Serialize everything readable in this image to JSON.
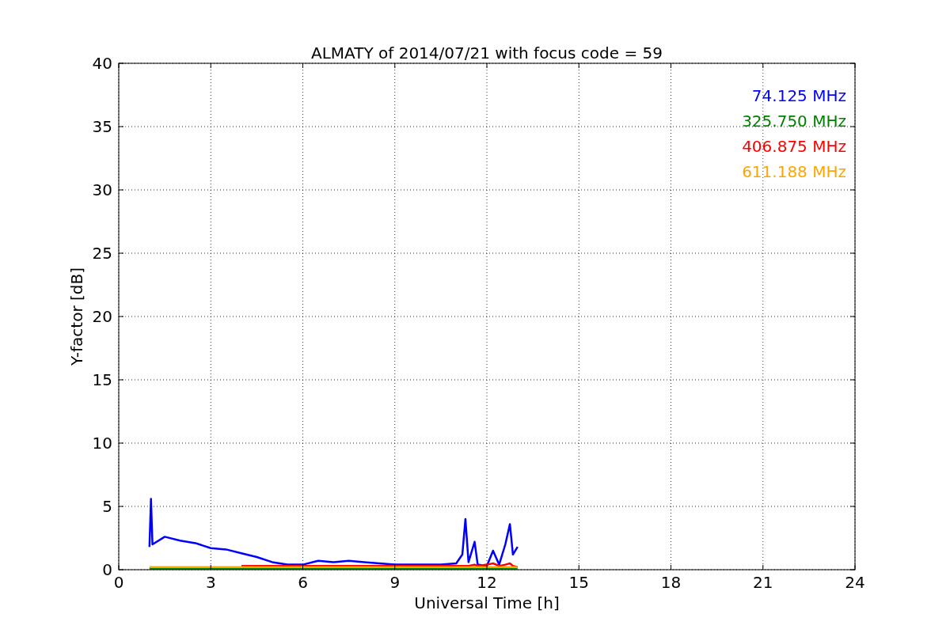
{
  "figure": {
    "chart_data": {
      "type": "line",
      "title": "ALMATY of 2014/07/21 with focus code = 59",
      "xlabel": "Universal Time [h]",
      "ylabel": "Y-factor [dB]",
      "x": [
        1.0,
        1.05,
        1.1,
        1.5,
        2,
        2.5,
        3,
        3.5,
        4,
        4.5,
        5,
        5.5,
        6,
        6.5,
        7,
        7.5,
        8,
        8.5,
        9,
        9.5,
        10,
        10.5,
        11,
        11.2,
        11.3,
        11.4,
        11.6,
        11.7,
        12,
        12.2,
        12.4,
        12.6,
        12.75,
        12.85,
        13
      ],
      "series": [
        {
          "name": "74.125 MHz",
          "color": "#0000ff",
          "values": [
            1.8,
            5.6,
            2.0,
            2.6,
            2.3,
            2.1,
            1.7,
            1.6,
            1.3,
            1.0,
            0.6,
            0.4,
            0.4,
            0.7,
            0.6,
            0.7,
            0.6,
            0.5,
            0.4,
            0.4,
            0.4,
            0.4,
            0.5,
            1.2,
            4.0,
            0.6,
            2.2,
            0.4,
            0.3,
            1.5,
            0.4,
            2.0,
            3.6,
            1.2,
            1.8
          ]
        },
        {
          "name": "325.750 MHz",
          "color": "#008000",
          "values": [
            0.1,
            0.1,
            0.1,
            0.1,
            0.1,
            0.1,
            0.1,
            0.1,
            0.1,
            0.1,
            0.1,
            0.1,
            0.1,
            0.1,
            0.1,
            0.1,
            0.1,
            0.1,
            0.1,
            0.1,
            0.1,
            0.1,
            0.1,
            0.1,
            0.1,
            0.1,
            0.1,
            0.1,
            0.1,
            0.1,
            0.1,
            0.1,
            0.1,
            0.1,
            0.1
          ]
        },
        {
          "name": "406.875 MHz",
          "color": "#ff0000",
          "values": [
            null,
            null,
            null,
            null,
            null,
            null,
            null,
            null,
            0.3,
            0.3,
            0.3,
            0.3,
            0.3,
            0.3,
            0.3,
            0.3,
            0.3,
            0.3,
            0.3,
            0.3,
            0.3,
            0.3,
            0.3,
            0.3,
            0.3,
            0.3,
            0.4,
            0.3,
            0.4,
            0.5,
            0.3,
            0.4,
            0.5,
            0.3,
            0.2
          ]
        },
        {
          "name": "611.188 MHz",
          "color": "#ffa500",
          "values": [
            0.2,
            0.2,
            0.2,
            0.2,
            0.2,
            0.2,
            0.2,
            0.2,
            0.2,
            0.2,
            0.2,
            0.2,
            0.2,
            0.2,
            0.2,
            0.2,
            0.2,
            0.2,
            0.2,
            0.2,
            0.2,
            0.2,
            0.2,
            0.2,
            0.2,
            0.2,
            0.2,
            0.2,
            0.2,
            0.2,
            0.2,
            0.2,
            0.2,
            0.2,
            0.2
          ]
        }
      ],
      "grid": true,
      "xlim": [
        0,
        24
      ],
      "ylim": [
        0,
        40
      ],
      "xticks": [
        0,
        3,
        6,
        9,
        12,
        15,
        18,
        21,
        24
      ],
      "yticks": [
        0,
        5,
        10,
        15,
        20,
        25,
        30,
        35,
        40
      ]
    }
  }
}
